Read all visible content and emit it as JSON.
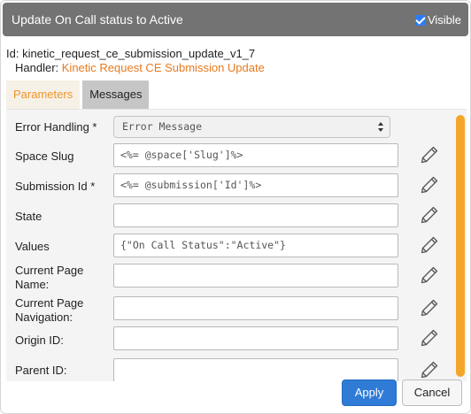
{
  "dialog": {
    "title": "Update On Call status to Active",
    "visible_label": "Visible",
    "visible_checked": true
  },
  "node": {
    "id_text": "Id: kinetic_request_ce_submission_update_v1_7",
    "handler_prefix": "Handler:",
    "handler_name": "Kinetic Request CE Submission Update"
  },
  "tabs": [
    {
      "label": "Parameters",
      "active": true
    },
    {
      "label": "Messages",
      "active": false
    }
  ],
  "parameters": {
    "error_handling": {
      "label": "Error Handling *",
      "value": "Error Message"
    },
    "rows": [
      {
        "label": "Space Slug",
        "value": "<%= @space['Slug']%>"
      },
      {
        "label": "Submission Id *",
        "value": "<%= @submission['Id']%>"
      },
      {
        "label": "State",
        "value": ""
      },
      {
        "label": "Values",
        "value": "{\"On Call Status\":\"Active\"}"
      },
      {
        "label": "Current Page Name:",
        "value": ""
      },
      {
        "label": "Current Page Navigation:",
        "value": ""
      },
      {
        "label": "Origin ID:",
        "value": ""
      },
      {
        "label": "Parent ID:",
        "value": ""
      }
    ]
  },
  "footer": {
    "apply_label": "Apply",
    "cancel_label": "Cancel"
  },
  "colors": {
    "titlebar": "#737373",
    "accent_orange": "#f0932b",
    "apply_blue": "#2f7bd6",
    "scrollbar": "#f4a62a"
  },
  "icons": {
    "row_action": "pencil-icon",
    "select_arrows": "select-arrows-icon",
    "visible_checkbox": "checkbox-checked-icon"
  }
}
